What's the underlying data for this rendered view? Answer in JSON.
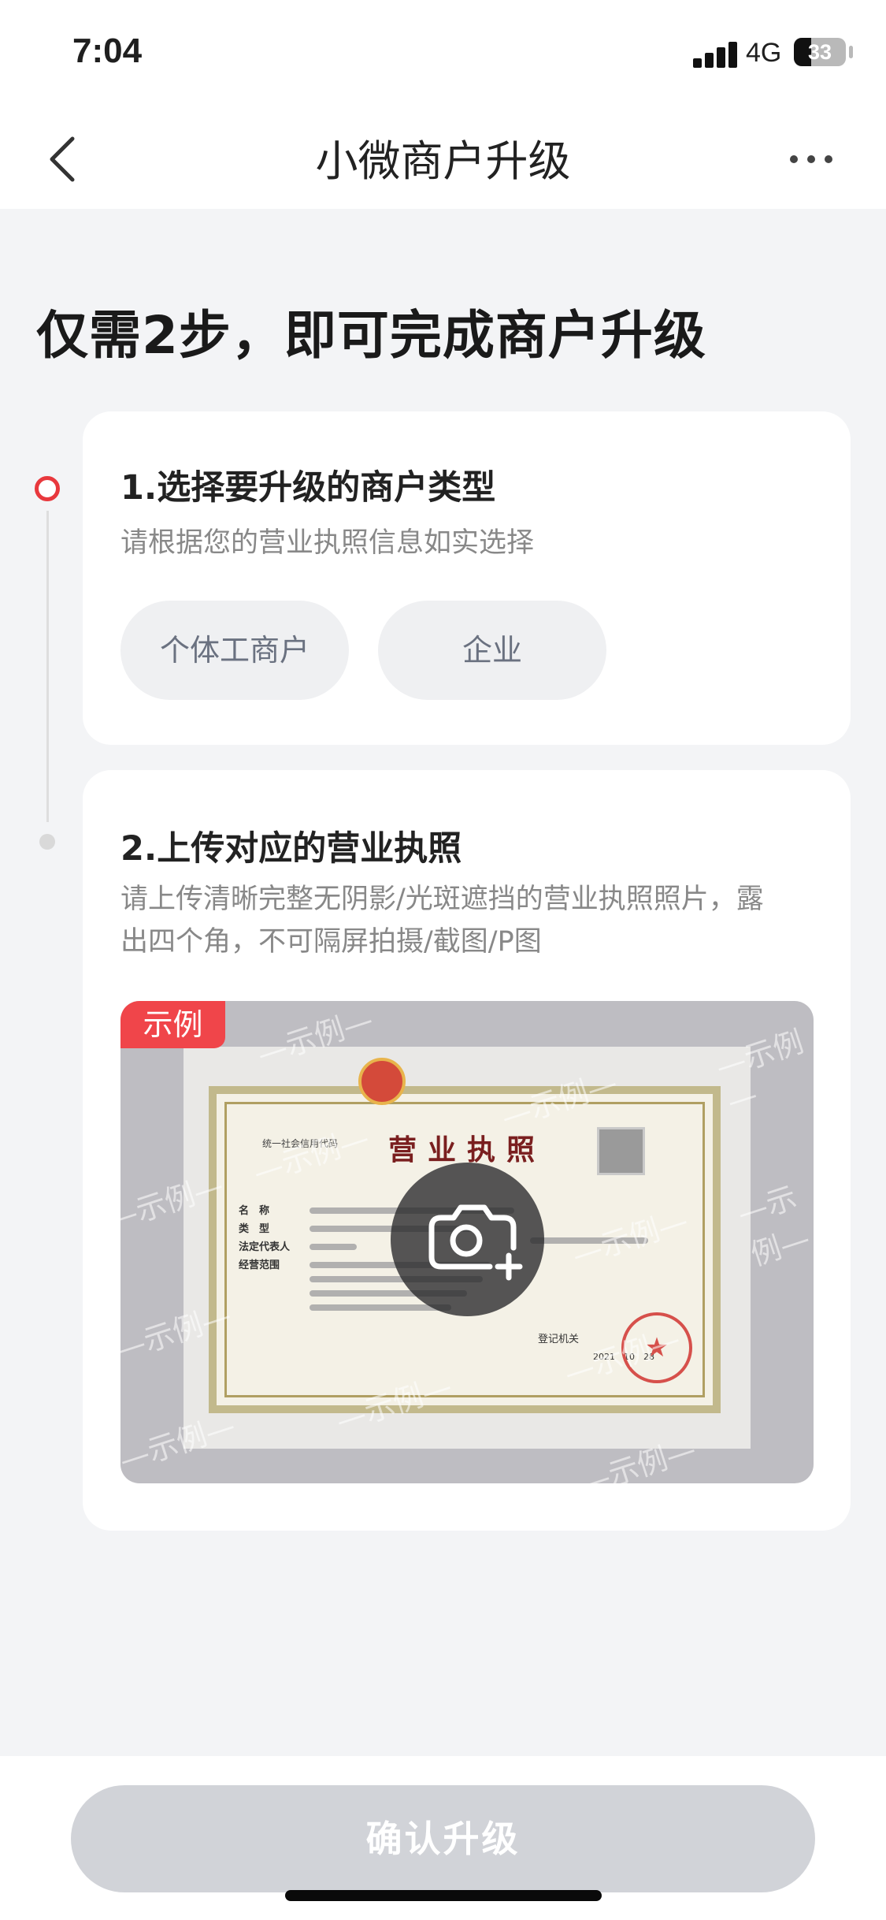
{
  "status_bar": {
    "time": "7:04",
    "network": "4G",
    "battery": "33",
    "battery_level": 0.33
  },
  "nav": {
    "title": "小微商户升级",
    "back_icon": "chevron-left-icon",
    "more_icon": "more-dots-icon"
  },
  "headline": "仅需2步，即可完成商户升级",
  "step1": {
    "title": "1.选择要升级的商户类型",
    "subtitle": "请根据您的营业执照信息如实选择",
    "options": [
      "个体工商户",
      "企业"
    ]
  },
  "step2": {
    "title": "2.上传对应的营业执照",
    "subtitle_line1": "请上传清晰完整无阴影/光斑遮挡的营业执照照片，露",
    "subtitle_line2": "出四个角，不可隔屏拍摄/截图/P图",
    "sample_tag": "示例",
    "license_title": "营业执照",
    "license_code_label": "统一社会信用代码",
    "license_fields": [
      "名　称",
      "类　型",
      "法定代表人",
      "经营范围"
    ],
    "license_authority": "登记机关",
    "license_date": "2021　10　28",
    "watermark": "—示例—",
    "upload_icon": "camera-plus-icon"
  },
  "confirm_button": "确认升级",
  "colors": {
    "accent": "#f0454a",
    "disabled_button": "#d1d3d8",
    "background": "#f3f4f6"
  }
}
